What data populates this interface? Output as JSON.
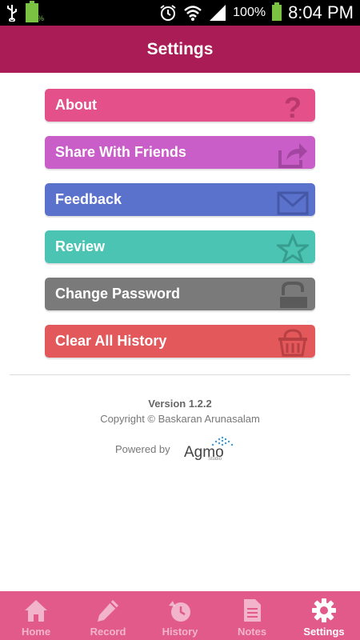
{
  "status_bar": {
    "battery_small_label": "100%",
    "battery_percent": "100%",
    "time": "8:04 PM"
  },
  "header": {
    "title": "Settings"
  },
  "menu": [
    {
      "label": "About",
      "color": "#e3508a",
      "icon": "question-icon"
    },
    {
      "label": "Share With Friends",
      "color": "#c95ec9",
      "icon": "share-icon"
    },
    {
      "label": "Feedback",
      "color": "#5b72cc",
      "icon": "envelope-icon"
    },
    {
      "label": "Review",
      "color": "#4bc4b3",
      "icon": "star-icon"
    },
    {
      "label": "Change Password",
      "color": "#7a7a7a",
      "icon": "lock-icon"
    },
    {
      "label": "Clear All History",
      "color": "#e2585b",
      "icon": "basket-icon"
    }
  ],
  "footer": {
    "version": "Version 1.2.2",
    "copyright": "Copyright © Baskaran Arunasalam",
    "powered_by": "Powered by",
    "brand": "Agmo",
    "brand_sub": "Studio"
  },
  "bottom_nav": [
    {
      "label": "Home",
      "icon": "home-icon",
      "active": false
    },
    {
      "label": "Record",
      "icon": "pencil-icon",
      "active": false
    },
    {
      "label": "History",
      "icon": "history-clock-icon",
      "active": false
    },
    {
      "label": "Notes",
      "icon": "notes-icon",
      "active": false
    },
    {
      "label": "Settings",
      "icon": "gear-icon",
      "active": true
    }
  ],
  "colors": {
    "header": "#a91c55",
    "bottom_nav": "#e15a8a"
  }
}
